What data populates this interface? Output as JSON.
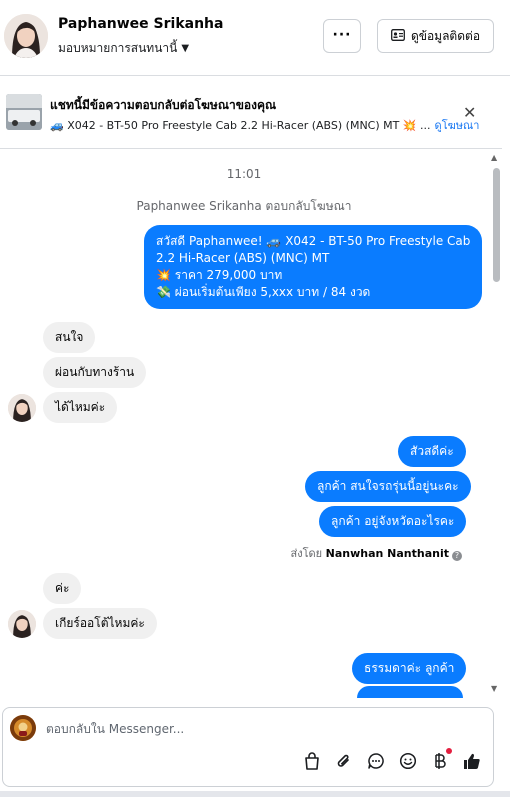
{
  "header": {
    "name": "Paphanwee Srikanha",
    "assign_label": "มอบหมายการสนทนานี้",
    "more_label": "···",
    "contact_label": "ดูข้อมูลติดต่อ"
  },
  "ad_banner": {
    "title": "แชทนี้มีข้อความตอบกลับต่อโฆษณาของคุณ",
    "subtitle": "🚙 X042 - BT-50 Pro Freestyle Cab 2.2 Hi-Racer (ABS) (MNC) MT 💥 ...",
    "link_label": "ดูโฆษณา",
    "close_label": "✕"
  },
  "chat": {
    "time": "11:01",
    "ad_reply_note": "Paphanwee Srikanha ตอบกลับโฆษณา",
    "ad_message": {
      "line1": "สวัสดี Paphanwee! 🚙 X042 - BT-50 Pro Freestyle Cab",
      "line2": "2.2 Hi-Racer (ABS) (MNC) MT",
      "line3": "💥 ราคา 279,000 บาท",
      "line4": "💸 ผ่อนเริ่มต้นเพียง 5,xxx บาท / 84 งวด"
    },
    "incoming_1": [
      "สนใจ",
      "ผ่อนกับทางร้าน",
      "ได้ไหมค่ะ"
    ],
    "outgoing_1": [
      "สัวสดีค่ะ",
      "ลูกค้า สนใจรถรุ่นนี้อยู่นะคะ",
      "ลูกค้า อยู่จังหวัดอะไรคะ"
    ],
    "sent_by_prefix": "ส่งโดย",
    "sent_by_name": "Nanwhan Nanthanit",
    "incoming_2": [
      "ค่ะ",
      "เกียร์ออโต้ไหมค่ะ"
    ],
    "outgoing_2": [
      "ธรรมดาค่ะ  ลูกค้า",
      ""
    ]
  },
  "composer": {
    "placeholder": "ตอบกลับใน Messenger..."
  },
  "colors": {
    "brand_blue": "#0a7cff",
    "incoming_bg": "#f0f0f0",
    "link": "#1877f2"
  }
}
